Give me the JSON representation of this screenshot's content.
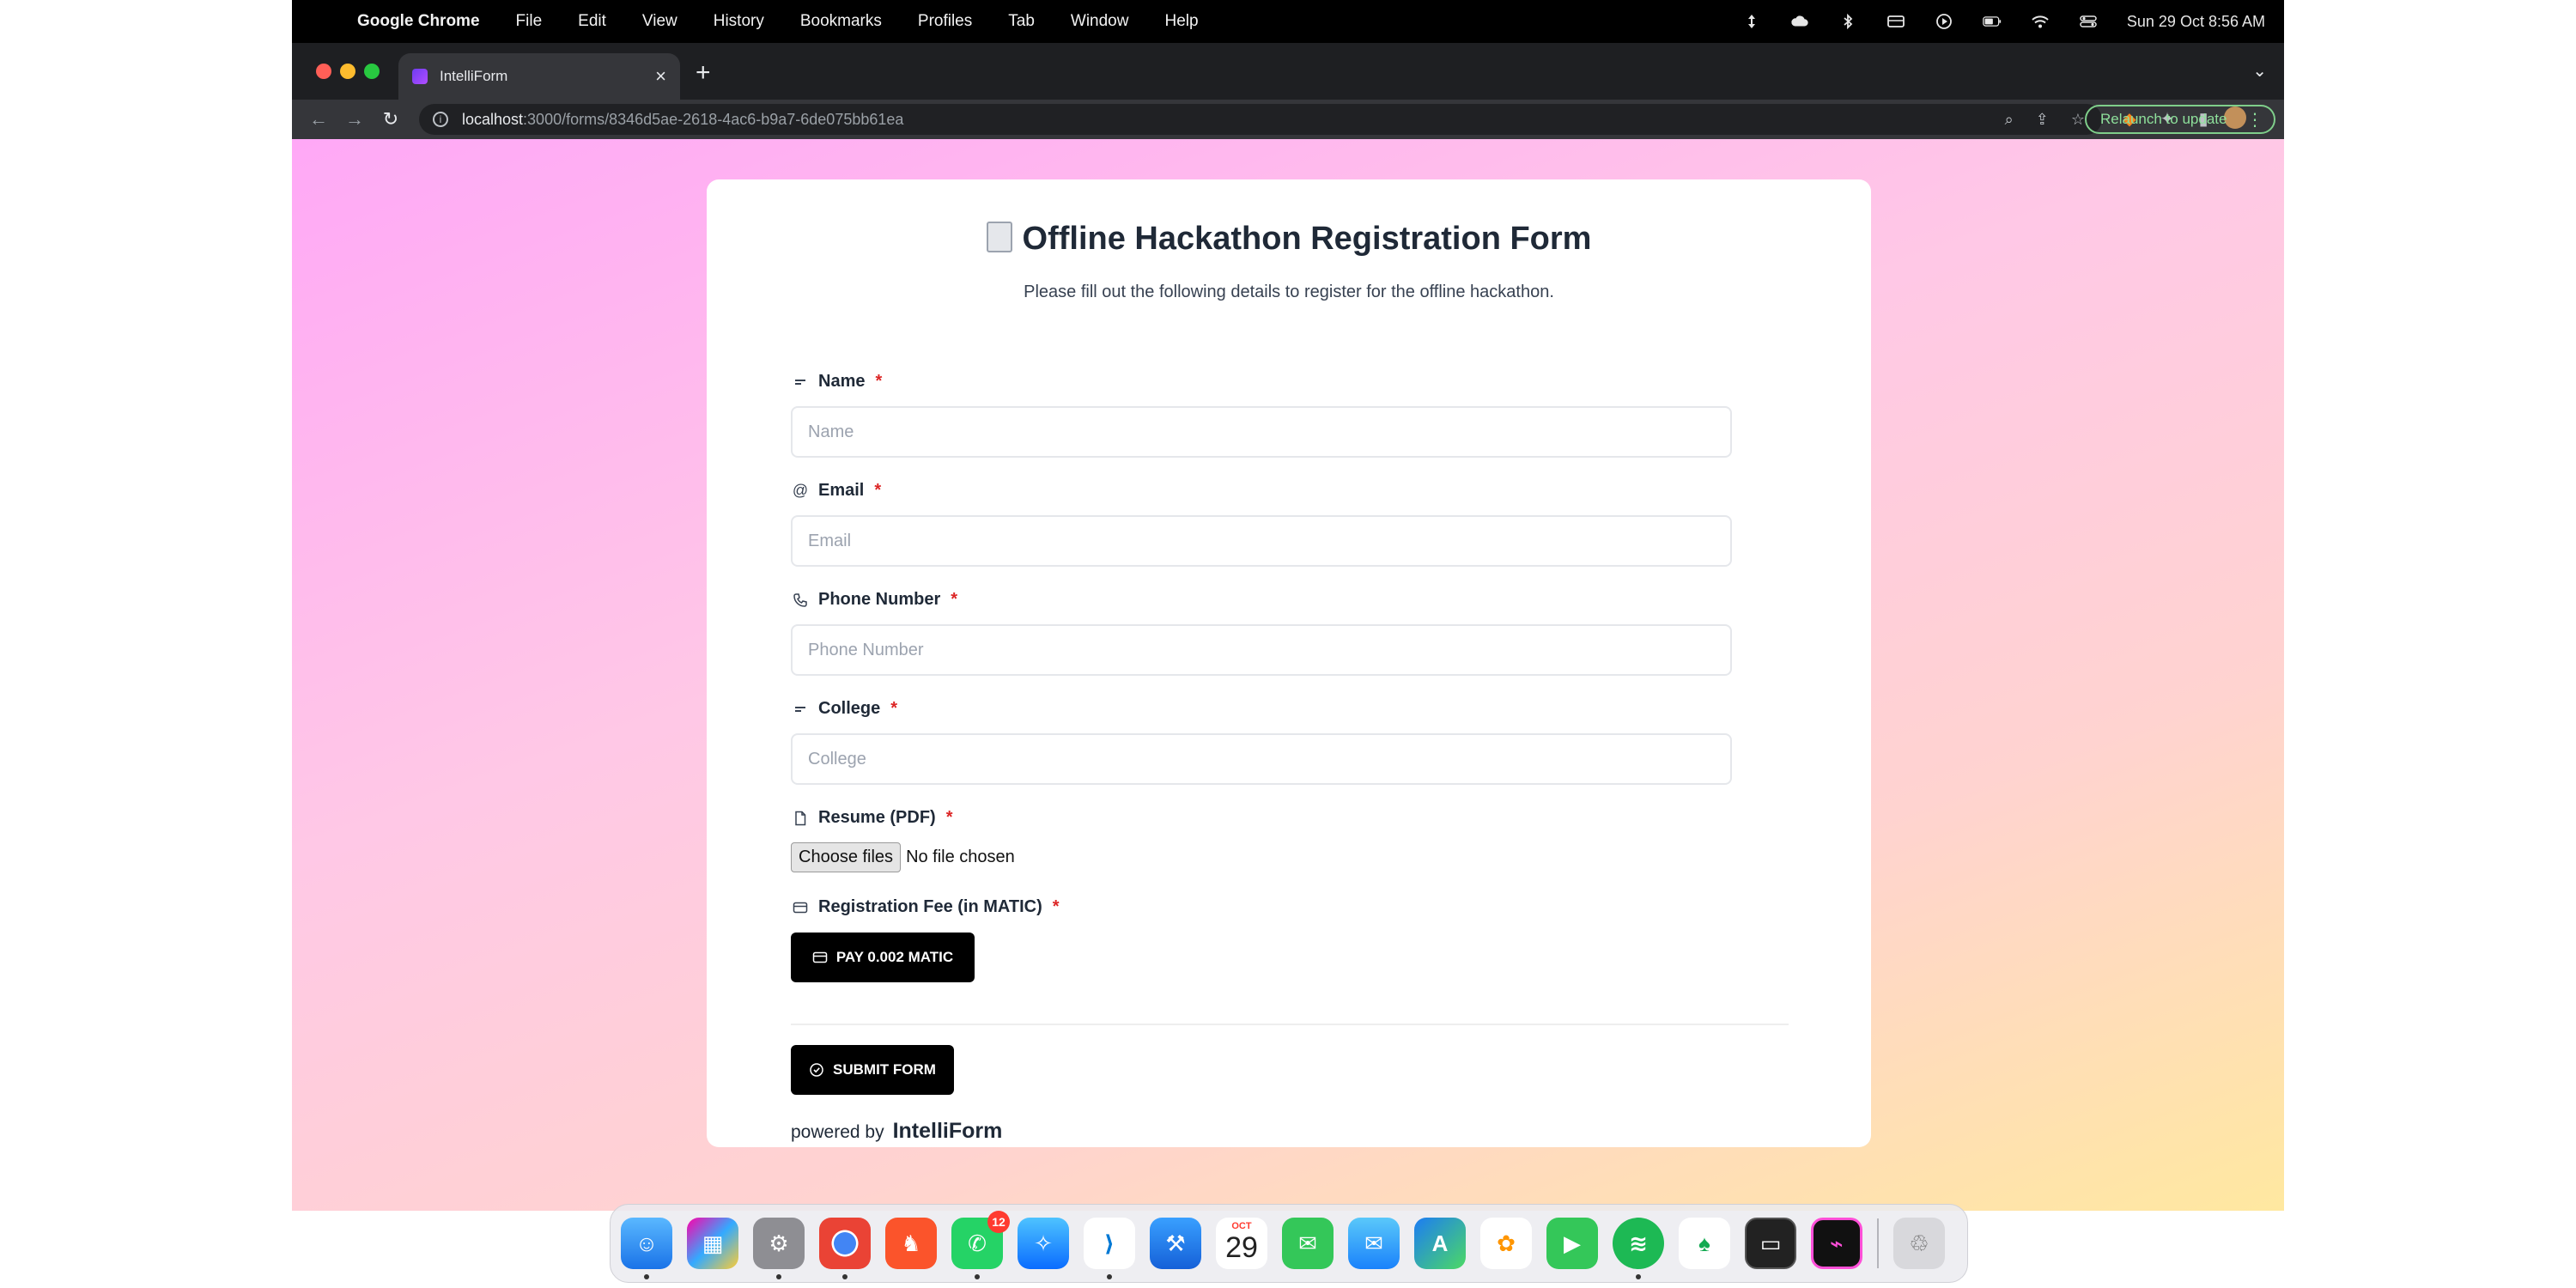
{
  "menubar": {
    "app_name": "Google Chrome",
    "menus": [
      "File",
      "Edit",
      "View",
      "History",
      "Bookmarks",
      "Profiles",
      "Tab",
      "Window",
      "Help"
    ],
    "clock": "Sun 29 Oct  8:56 AM"
  },
  "browser": {
    "tab_title": "IntelliForm",
    "new_tab_symbol": "+",
    "url_host": "localhost",
    "url_path": ":3000/forms/8346d5ae-2618-4ac6-b9a7-6de075bb61ea",
    "relaunch_label": "Relaunch to update"
  },
  "form": {
    "title": "Offline Hackathon Registration Form",
    "subtitle": "Please fill out the following details to register for the offline hackathon.",
    "required_marker": "*",
    "fields": [
      {
        "label": "Name",
        "placeholder": "Name",
        "icon": "text-lines-icon"
      },
      {
        "label": "Email",
        "placeholder": "Email",
        "icon": "at-sign-icon"
      },
      {
        "label": "Phone Number",
        "placeholder": "Phone Number",
        "icon": "phone-icon"
      },
      {
        "label": "College",
        "placeholder": "College",
        "icon": "text-lines-icon"
      }
    ],
    "resume": {
      "label": "Resume (PDF)",
      "button": "Choose files",
      "status": "No file chosen",
      "icon": "file-icon"
    },
    "fee": {
      "label": "Registration Fee (in MATIC)",
      "button": "PAY 0.002 MATIC",
      "icon": "credit-card-icon"
    },
    "submit_label": "SUBMIT FORM",
    "powered_by": "powered by",
    "brand": "IntelliForm"
  },
  "dock": {
    "whatsapp_badge": "12",
    "calendar_month": "OCT",
    "calendar_day": "29"
  },
  "colors": {
    "required": "#dc2626",
    "button_bg": "#000000",
    "relaunch": "#8ee09b"
  }
}
